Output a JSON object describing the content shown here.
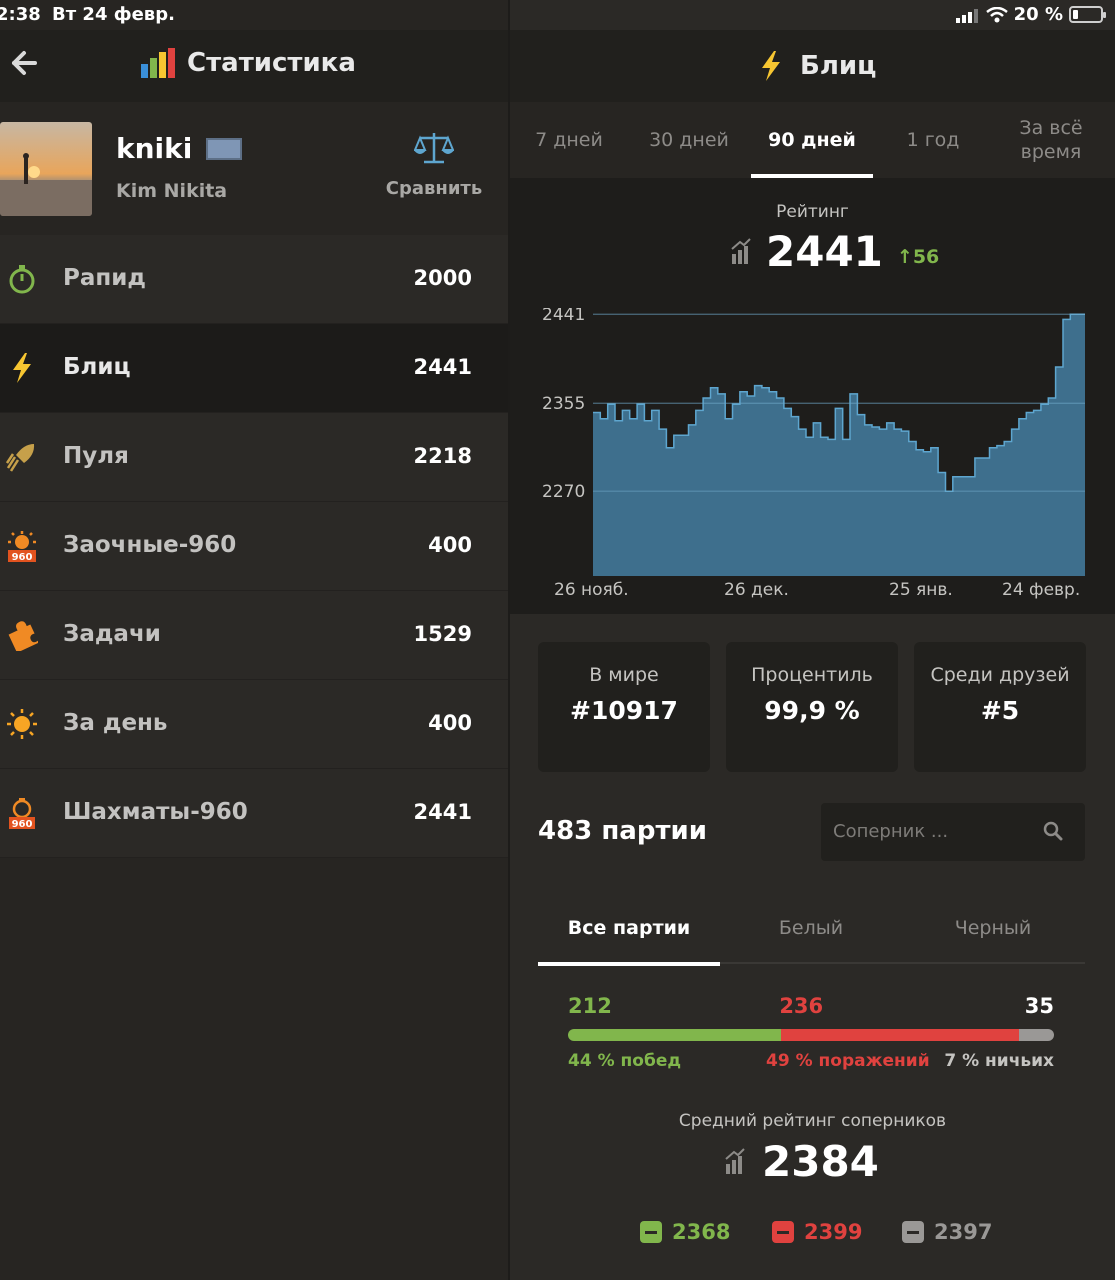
{
  "status_bar": {
    "time": "2:38",
    "date": "Вт 24 февр.",
    "battery": "20 %"
  },
  "left": {
    "title": "Статистика",
    "profile": {
      "username": "kniki",
      "real_name": "Kim Nikita",
      "compare_label": "Сравнить"
    },
    "modes": [
      {
        "name": "Рапид",
        "value": "2000",
        "icon": "stopwatch-icon",
        "active": false
      },
      {
        "name": "Блиц",
        "value": "2441",
        "icon": "lightning-icon",
        "active": true
      },
      {
        "name": "Пуля",
        "value": "2218",
        "icon": "bullet-icon",
        "active": false
      },
      {
        "name": "Заочные-960",
        "value": "400",
        "icon": "daily-960-icon",
        "active": false
      },
      {
        "name": "Задачи",
        "value": "1529",
        "icon": "puzzle-icon",
        "active": false
      },
      {
        "name": "За день",
        "value": "400",
        "icon": "sun-icon",
        "active": false
      },
      {
        "name": "Шахматы-960",
        "value": "2441",
        "icon": "chess960-icon",
        "active": false
      }
    ]
  },
  "right": {
    "title": "Блиц",
    "period_tabs": [
      {
        "label": "7 дней",
        "active": false
      },
      {
        "label": "30 дней",
        "active": false
      },
      {
        "label": "90 дней",
        "active": true
      },
      {
        "label": "1 год",
        "active": false
      },
      {
        "label": "За всё время",
        "active": false
      }
    ],
    "rating_label": "Рейтинг",
    "rating_value": "2441",
    "rating_delta": "56",
    "cards": [
      {
        "label": "В мире",
        "value": "#10917"
      },
      {
        "label": "Процентиль",
        "value": "99,9 %"
      },
      {
        "label": "Среди друзей",
        "value": "#5"
      }
    ],
    "games_count": "483 партии",
    "search_placeholder": "Соперник ...",
    "color_tabs": [
      {
        "label": "Все партии",
        "active": true
      },
      {
        "label": "Белый",
        "active": false
      },
      {
        "label": "Черный",
        "active": false
      }
    ],
    "wins": "212",
    "losses": "236",
    "draws": "35",
    "wins_label": "44 % побед",
    "losses_label": "49 % поражений",
    "draws_label": "7 % ничьих",
    "avg_opp_label": "Средний рейтинг соперников",
    "avg_opp_value": "2384",
    "opp_by_result": [
      {
        "kind": "win",
        "value": "2368"
      },
      {
        "kind": "loss",
        "value": "2399"
      },
      {
        "kind": "draw",
        "value": "2397"
      }
    ]
  },
  "colors": {
    "win": "#81b64c",
    "loss": "#e0423f",
    "draw": "#9a9896",
    "chart_fill": "#3e6f8d",
    "chart_line": "#5ea6cf",
    "accent_yellow": "#f7c631"
  },
  "chart_data": {
    "type": "area",
    "title": "",
    "xlabel": "",
    "ylabel": "",
    "x_tick_labels": [
      "26 нояб.",
      "26 дек.",
      "25 янв.",
      "24 февр."
    ],
    "y_ticks": [
      2441,
      2355,
      2270
    ],
    "ylim": [
      2188,
      2447
    ],
    "grid": true,
    "series": [
      {
        "values": [
          2346,
          2340,
          2354,
          2338,
          2348,
          2340,
          2354,
          2338,
          2348,
          2330,
          2312,
          2324,
          2324,
          2334,
          2348,
          2360,
          2370,
          2364,
          2340,
          2354,
          2366,
          2362,
          2372,
          2370,
          2366,
          2360,
          2350,
          2342,
          2330,
          2322,
          2336,
          2322,
          2320,
          2350,
          2320,
          2364,
          2344,
          2334,
          2332,
          2330,
          2336,
          2330,
          2328,
          2318,
          2310,
          2308,
          2312,
          2288,
          2270,
          2284,
          2284,
          2284,
          2302,
          2302,
          2312,
          2314,
          2318,
          2330,
          2340,
          2346,
          2348,
          2354,
          2360,
          2390,
          2436,
          2441,
          2441
        ]
      }
    ]
  }
}
